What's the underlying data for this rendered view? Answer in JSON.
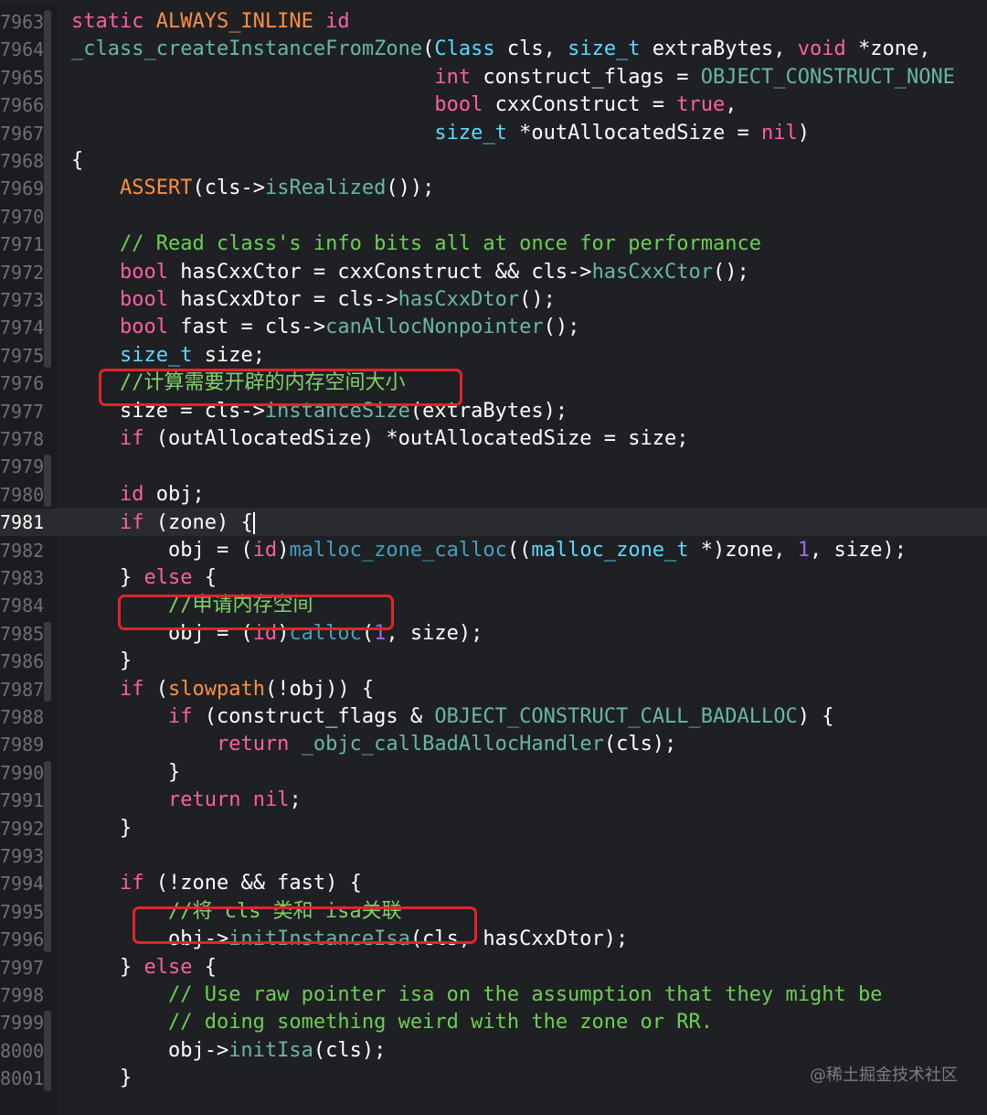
{
  "editor": {
    "theme": {
      "background": "#1f2024",
      "gutter": "#1b1c1f",
      "current_line": "#2a2b2f",
      "keyword": "#fc5fa3",
      "macro": "#fd8f3f",
      "type": "#5dd8ff",
      "function": "#67b7a4",
      "comment": "#6bd052",
      "number": "#d0bf69",
      "highlight_box": "#e0252b"
    },
    "current_line_number": "7981",
    "lines": [
      {
        "n": "7963",
        "tokens": [
          [
            "kw",
            "static "
          ],
          [
            "mac",
            "ALWAYS_INLINE "
          ],
          [
            "kw",
            "id"
          ]
        ]
      },
      {
        "n": "7964",
        "tokens": [
          [
            "fn",
            "_class_createInstanceFromZone"
          ],
          [
            "pl",
            "("
          ],
          [
            "ty",
            "Class"
          ],
          [
            "pl",
            " cls, "
          ],
          [
            "ty",
            "size_t"
          ],
          [
            "pl",
            " extraBytes, "
          ],
          [
            "kw",
            "void"
          ],
          [
            "pl",
            " *zone,"
          ]
        ]
      },
      {
        "n": "7965",
        "tokens": [
          [
            "pl",
            "                              "
          ],
          [
            "kw",
            "int"
          ],
          [
            "pl",
            " construct_flags = "
          ],
          [
            "fn",
            "OBJECT_CONSTRUCT_NONE"
          ]
        ]
      },
      {
        "n": "7966",
        "tokens": [
          [
            "pl",
            "                              "
          ],
          [
            "kw",
            "bool"
          ],
          [
            "pl",
            " cxxConstruct = "
          ],
          [
            "kw",
            "true"
          ],
          [
            "pl",
            ","
          ]
        ]
      },
      {
        "n": "7967",
        "tokens": [
          [
            "pl",
            "                              "
          ],
          [
            "ty",
            "size_t"
          ],
          [
            "pl",
            " *outAllocatedSize = "
          ],
          [
            "kw",
            "nil"
          ],
          [
            "pl",
            ")"
          ]
        ]
      },
      {
        "n": "7968",
        "tokens": [
          [
            "pl",
            "{"
          ]
        ]
      },
      {
        "n": "7969",
        "tokens": [
          [
            "pl",
            "    "
          ],
          [
            "mac",
            "ASSERT"
          ],
          [
            "pl",
            "(cls->"
          ],
          [
            "fn",
            "isRealized"
          ],
          [
            "pl",
            "());"
          ]
        ]
      },
      {
        "n": "7970",
        "tokens": []
      },
      {
        "n": "7971",
        "tokens": [
          [
            "pl",
            "    "
          ],
          [
            "cm",
            "// Read class's info bits all at once for performance"
          ]
        ]
      },
      {
        "n": "7972",
        "tokens": [
          [
            "pl",
            "    "
          ],
          [
            "kw",
            "bool"
          ],
          [
            "pl",
            " hasCxxCtor = cxxConstruct && cls->"
          ],
          [
            "fn",
            "hasCxxCtor"
          ],
          [
            "pl",
            "();"
          ]
        ]
      },
      {
        "n": "7973",
        "tokens": [
          [
            "pl",
            "    "
          ],
          [
            "kw",
            "bool"
          ],
          [
            "pl",
            " hasCxxDtor = cls->"
          ],
          [
            "fn",
            "hasCxxDtor"
          ],
          [
            "pl",
            "();"
          ]
        ]
      },
      {
        "n": "7974",
        "tokens": [
          [
            "pl",
            "    "
          ],
          [
            "kw",
            "bool"
          ],
          [
            "pl",
            " fast = cls->"
          ],
          [
            "fn",
            "canAllocNonpointer"
          ],
          [
            "pl",
            "();"
          ]
        ]
      },
      {
        "n": "7975",
        "tokens": [
          [
            "pl",
            "    "
          ],
          [
            "ty",
            "size_t"
          ],
          [
            "pl",
            " size;"
          ]
        ]
      },
      {
        "n": "7976",
        "tokens": [
          [
            "pl",
            "    "
          ],
          [
            "cmz",
            "//计算需要开辟的内存空间大小"
          ]
        ]
      },
      {
        "n": "7977",
        "tokens": [
          [
            "pl",
            "    size = cls->"
          ],
          [
            "fn",
            "instanceSize"
          ],
          [
            "pl",
            "(extraBytes);"
          ]
        ]
      },
      {
        "n": "7978",
        "tokens": [
          [
            "pl",
            "    "
          ],
          [
            "kw",
            "if"
          ],
          [
            "pl",
            " (outAllocatedSize) *outAllocatedSize = size;"
          ]
        ]
      },
      {
        "n": "7979",
        "tokens": []
      },
      {
        "n": "7980",
        "tokens": [
          [
            "pl",
            "    "
          ],
          [
            "kw",
            "id"
          ],
          [
            "pl",
            " obj;"
          ]
        ]
      },
      {
        "n": "7981",
        "tokens": [
          [
            "pl",
            "    "
          ],
          [
            "kw",
            "if"
          ],
          [
            "pl",
            " (zone) {"
          ]
        ]
      },
      {
        "n": "7982",
        "tokens": [
          [
            "pl",
            "        obj = ("
          ],
          [
            "kw",
            "id"
          ],
          [
            "pl",
            ")"
          ],
          [
            "fnc",
            "malloc_zone_calloc"
          ],
          [
            "pl",
            "(("
          ],
          [
            "ty",
            "malloc_zone_t"
          ],
          [
            "pl",
            " *)zone, "
          ],
          [
            "cn",
            "1"
          ],
          [
            "pl",
            ", size);"
          ]
        ]
      },
      {
        "n": "7983",
        "tokens": [
          [
            "pl",
            "    } "
          ],
          [
            "kw",
            "else"
          ],
          [
            "pl",
            " {"
          ]
        ]
      },
      {
        "n": "7984",
        "tokens": [
          [
            "pl",
            "        "
          ],
          [
            "cmz",
            "//申请内存空间"
          ]
        ]
      },
      {
        "n": "7985",
        "tokens": [
          [
            "pl",
            "        obj = ("
          ],
          [
            "kw",
            "id"
          ],
          [
            "pl",
            ")"
          ],
          [
            "fnc",
            "calloc"
          ],
          [
            "pl",
            "("
          ],
          [
            "cn",
            "1"
          ],
          [
            "pl",
            ", size);"
          ]
        ]
      },
      {
        "n": "7986",
        "tokens": [
          [
            "pl",
            "    }"
          ]
        ]
      },
      {
        "n": "7987",
        "tokens": [
          [
            "pl",
            "    "
          ],
          [
            "kw",
            "if"
          ],
          [
            "pl",
            " ("
          ],
          [
            "mac",
            "slowpath"
          ],
          [
            "pl",
            "(!obj)) {"
          ]
        ]
      },
      {
        "n": "7988",
        "tokens": [
          [
            "pl",
            "        "
          ],
          [
            "kw",
            "if"
          ],
          [
            "pl",
            " (construct_flags & "
          ],
          [
            "fn",
            "OBJECT_CONSTRUCT_CALL_BADALLOC"
          ],
          [
            "pl",
            ") {"
          ]
        ]
      },
      {
        "n": "7989",
        "tokens": [
          [
            "pl",
            "            "
          ],
          [
            "kw",
            "return"
          ],
          [
            "pl",
            " "
          ],
          [
            "fn",
            "_objc_callBadAllocHandler"
          ],
          [
            "pl",
            "(cls);"
          ]
        ]
      },
      {
        "n": "7990",
        "tokens": [
          [
            "pl",
            "        }"
          ]
        ]
      },
      {
        "n": "7991",
        "tokens": [
          [
            "pl",
            "        "
          ],
          [
            "kw",
            "return"
          ],
          [
            "pl",
            " "
          ],
          [
            "kw",
            "nil"
          ],
          [
            "pl",
            ";"
          ]
        ]
      },
      {
        "n": "7992",
        "tokens": [
          [
            "pl",
            "    }"
          ]
        ]
      },
      {
        "n": "7993",
        "tokens": []
      },
      {
        "n": "7994",
        "tokens": [
          [
            "pl",
            "    "
          ],
          [
            "kw",
            "if"
          ],
          [
            "pl",
            " (!zone && fast) {"
          ]
        ]
      },
      {
        "n": "7995",
        "tokens": [
          [
            "pl",
            "        "
          ],
          [
            "cmz",
            "//将 cls 类和 isa关联"
          ]
        ]
      },
      {
        "n": "7996",
        "tokens": [
          [
            "pl",
            "        obj->"
          ],
          [
            "fn",
            "initInstanceIsa"
          ],
          [
            "pl",
            "(cls, hasCxxDtor);"
          ]
        ]
      },
      {
        "n": "7997",
        "tokens": [
          [
            "pl",
            "    } "
          ],
          [
            "kw",
            "else"
          ],
          [
            "pl",
            " {"
          ]
        ]
      },
      {
        "n": "7998",
        "tokens": [
          [
            "pl",
            "        "
          ],
          [
            "cm",
            "// Use raw pointer isa on the assumption that they might be"
          ]
        ]
      },
      {
        "n": "7999",
        "tokens": [
          [
            "pl",
            "        "
          ],
          [
            "cm",
            "// doing something weird with the zone or RR."
          ]
        ]
      },
      {
        "n": "8000",
        "tokens": [
          [
            "pl",
            "        obj->"
          ],
          [
            "fn",
            "initIsa"
          ],
          [
            "pl",
            "(cls);"
          ]
        ]
      },
      {
        "n": "8001",
        "tokens": [
          [
            "pl",
            "    }"
          ]
        ]
      }
    ]
  },
  "watermark": "@稀土掘金技术社区"
}
